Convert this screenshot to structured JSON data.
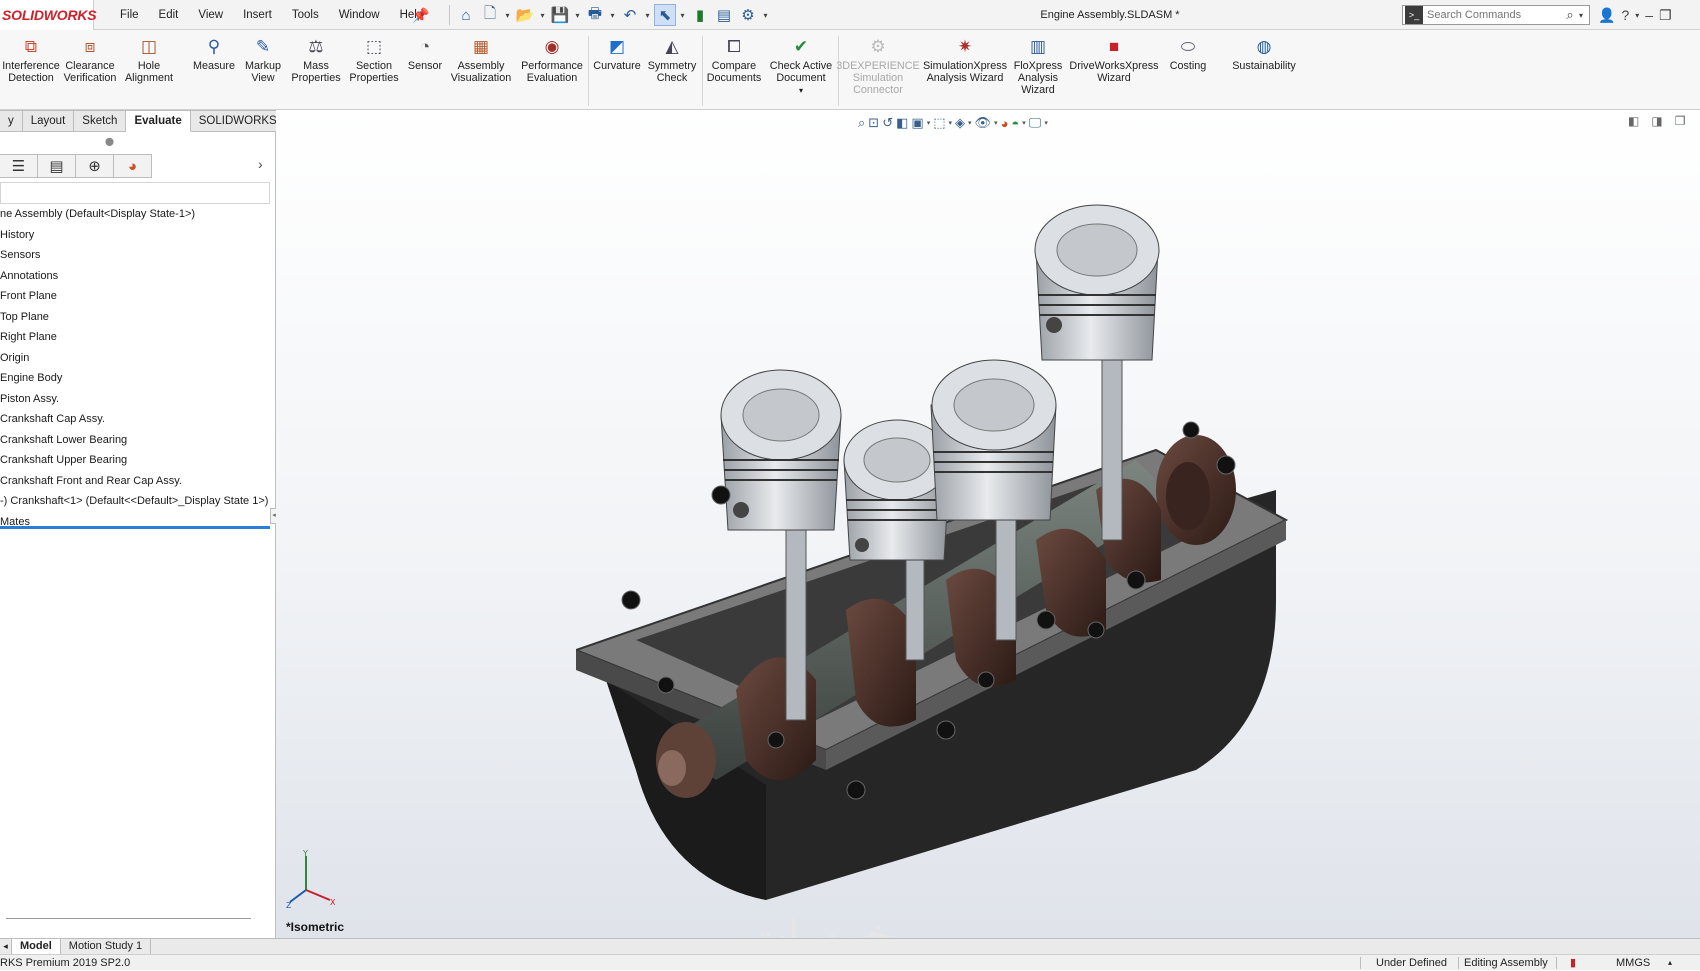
{
  "app": {
    "logo": "SOLIDWORKS",
    "document_title": "Engine Assembly.SLDASM *"
  },
  "menubar": {
    "items": [
      "File",
      "Edit",
      "View",
      "Insert",
      "Tools",
      "Window",
      "Help"
    ]
  },
  "search": {
    "placeholder": "Search Commands"
  },
  "ribbon": {
    "commands": [
      {
        "label": "Interference\nDetection",
        "icon": "interference-icon",
        "enabled": true
      },
      {
        "label": "Clearance\nVerification",
        "icon": "clearance-icon",
        "enabled": true
      },
      {
        "label": "Hole\nAlignment",
        "icon": "hole-alignment-icon",
        "enabled": true
      },
      {
        "label": "Measure",
        "icon": "measure-icon",
        "enabled": true
      },
      {
        "label": "Markup\nView",
        "icon": "markup-icon",
        "enabled": true
      },
      {
        "label": "Mass\nProperties",
        "icon": "mass-properties-icon",
        "enabled": true
      },
      {
        "label": "Section\nProperties",
        "icon": "section-properties-icon",
        "enabled": true
      },
      {
        "label": "Sensor",
        "icon": "sensor-icon",
        "enabled": true
      },
      {
        "label": "Assembly\nVisualization",
        "icon": "assembly-visualization-icon",
        "enabled": true
      },
      {
        "label": "Performance\nEvaluation",
        "icon": "performance-icon",
        "enabled": true
      },
      {
        "label": "Curvature",
        "icon": "curvature-icon",
        "enabled": true
      },
      {
        "label": "Symmetry\nCheck",
        "icon": "symmetry-icon",
        "enabled": true
      },
      {
        "label": "Compare\nDocuments",
        "icon": "compare-icon",
        "enabled": true
      },
      {
        "label": "Check Active\nDocument",
        "icon": "check-document-icon",
        "enabled": true
      },
      {
        "label": "3DEXPERIENCE\nSimulation\nConnector",
        "icon": "simulation-connector-icon",
        "enabled": false
      },
      {
        "label": "SimulationXpress\nAnalysis Wizard",
        "icon": "simulationxpress-icon",
        "enabled": true
      },
      {
        "label": "FloXpress\nAnalysis\nWizard",
        "icon": "floxpress-icon",
        "enabled": true
      },
      {
        "label": "DriveWorksXpress\nWizard",
        "icon": "driveworks-icon",
        "enabled": true
      },
      {
        "label": "Costing",
        "icon": "costing-icon",
        "enabled": true
      },
      {
        "label": "Sustainability",
        "icon": "sustainability-icon",
        "enabled": true
      }
    ]
  },
  "tabs": {
    "items": [
      "y",
      "Layout",
      "Sketch",
      "Evaluate",
      "SOLIDWORKS Add-Ins"
    ],
    "active": "Evaluate"
  },
  "feature_tree": {
    "root": "ne Assembly  (Default<Display State-1>)",
    "items": [
      "History",
      "Sensors",
      "Annotations",
      "Front Plane",
      "Top Plane",
      "Right Plane",
      "Origin",
      "Engine Body",
      "Piston Assy.",
      "Crankshaft Cap Assy.",
      "Crankshaft Lower Bearing",
      "Crankshaft Upper Bearing",
      "Crankshaft Front and Rear Cap Assy.",
      "-) Crankshaft<1> (Default<<Default>_Display State 1>)",
      "Mates"
    ]
  },
  "viewport": {
    "view_name": "*Isometric",
    "watermark": "خمسات"
  },
  "bottom_tabs": {
    "items": [
      "Model",
      "Motion Study 1"
    ],
    "active": "Model"
  },
  "status": {
    "product": "RKS Premium 2019 SP2.0",
    "state": "Under Defined",
    "mode": "Editing Assembly",
    "units": "MMGS"
  },
  "colors": {
    "logo_red": "#d0202a",
    "accent_blue": "#2a7ed8",
    "engine_block": "#2b2b2b",
    "block_flange": "#6a6a6a",
    "piston_grey": "#c9cdd2",
    "crank_brown": "#4a2c25"
  }
}
